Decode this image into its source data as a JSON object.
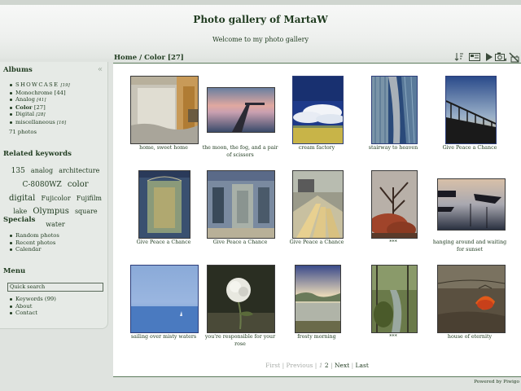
{
  "site": {
    "title": "Photo gallery of MartaW",
    "welcome": "Welcome to my photo gallery"
  },
  "breadcrumb": {
    "home": "Home",
    "separator": " / ",
    "category": "Color",
    "count": "[27]"
  },
  "toolbar": {
    "icons": [
      "sort-icon",
      "slideshow-view-icon",
      "play-icon",
      "camera-icon",
      "calendar-icon"
    ]
  },
  "sidebar": {
    "collapse_glyph": "«",
    "albums": {
      "title": "Albums",
      "items": [
        {
          "label": "SHOWCASE",
          "count": "[19]"
        },
        {
          "label": "Monochrome",
          "count": "[44]"
        },
        {
          "label": "Analog",
          "count": "[41]"
        },
        {
          "label": "Color",
          "count": "[27]"
        },
        {
          "label": "Digital",
          "count": "[28]"
        },
        {
          "label": "miscellaneous",
          "count": "[16]"
        }
      ],
      "total": "71 photos"
    },
    "keywords": {
      "title": "Related keywords",
      "tags": [
        "135",
        "analog",
        "architecture",
        "C-8080WZ",
        "color",
        "digital",
        "Fujicolor",
        "Fujifilm",
        "lake",
        "Olympus",
        "square",
        "water"
      ]
    },
    "specials": {
      "title": "Specials",
      "items": [
        "Random photos",
        "Recent photos",
        "Calendar"
      ]
    },
    "menu": {
      "title": "Menu",
      "search_placeholder": "Quick search",
      "items": [
        "Keywords (99)",
        "About",
        "Contact"
      ]
    }
  },
  "thumbnails": [
    {
      "caption": "home, sweet home"
    },
    {
      "caption": "the moon, the fog, and a pair of scissors"
    },
    {
      "caption": "cream factory"
    },
    {
      "caption": "stairway to heaven"
    },
    {
      "caption": "Give Peace a Chance"
    },
    {
      "caption": "Give Peace a Chance"
    },
    {
      "caption": "Give Peace a Chance"
    },
    {
      "caption": "Give Peace a Chance"
    },
    {
      "caption": "***"
    },
    {
      "caption": "hanging around and waiting for sunset"
    },
    {
      "caption": "sailing over misty waters"
    },
    {
      "caption": "you're responsible for your rose"
    },
    {
      "caption": "frosty morning"
    },
    {
      "caption": "***"
    },
    {
      "caption": "house of eternity"
    }
  ],
  "pagination": {
    "first": "First",
    "previous": "Previous",
    "pages": [
      "1",
      "2"
    ],
    "next": "Next",
    "last": "Last",
    "separator": "|"
  },
  "footer": {
    "powered_by": "Powered by Piwigo"
  },
  "colors": {
    "accent": "#1e3a1e",
    "rule": "#5c7a5c",
    "sidebar_bg": "#e6eae6",
    "page_bg": "#dfe3df"
  }
}
